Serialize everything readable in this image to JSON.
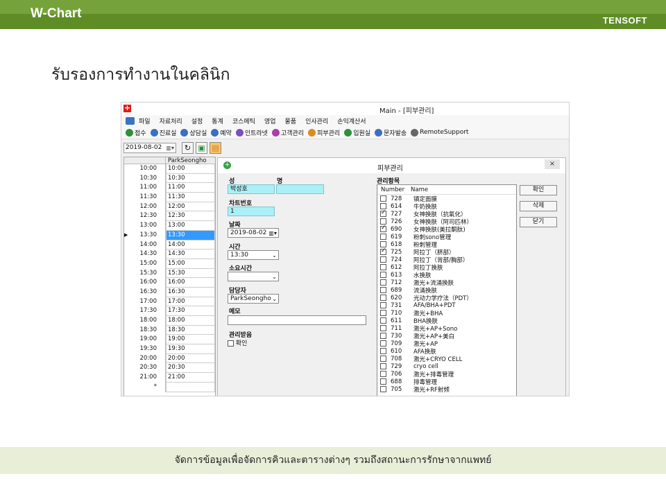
{
  "header": {
    "brand": "W-Chart",
    "company": "TENSOFT"
  },
  "slide_title": "รับรองการทำงานในคลินิก",
  "footer_text": "จัดการข้อมูลเพื่อจัดการคิวและตารางต่างๆ รวมถึงสถานะการรักษาจากแพทย์",
  "app": {
    "title": "Main - [피부관리]",
    "menu": [
      "파일",
      "자료처리",
      "설정",
      "통계",
      "코스메틱",
      "영업",
      "물품",
      "인사관리",
      "손익계산서"
    ],
    "toolbar": [
      {
        "label": "접수",
        "icon": "reception-icon",
        "color": "#2f8f3b"
      },
      {
        "label": "진료실",
        "icon": "doctor-icon",
        "color": "#3a6fc4"
      },
      {
        "label": "상담실",
        "icon": "consult-icon",
        "color": "#3a6fc4"
      },
      {
        "label": "예약",
        "icon": "reservation-icon",
        "color": "#3a6fc4"
      },
      {
        "label": "인트라넷",
        "icon": "intranet-icon",
        "color": "#7a4fc2"
      },
      {
        "label": "고객관리",
        "icon": "customer-icon",
        "color": "#b03ab0"
      },
      {
        "label": "피부관리",
        "icon": "skincare-icon",
        "color": "#e08a1e"
      },
      {
        "label": "입원실",
        "icon": "ward-icon",
        "color": "#2f8f3b"
      },
      {
        "label": "문자발송",
        "icon": "sms-icon",
        "color": "#3a6fc4"
      },
      {
        "label": "RemoteSupport",
        "icon": "remote-icon",
        "color": "#666666"
      }
    ],
    "date": "2019-08-02",
    "schedule": {
      "column": "ParkSeongho",
      "selected": "13:30",
      "rows": [
        {
          "time": "10:00",
          "cell": "10:00"
        },
        {
          "time": "10:30",
          "cell": "10:30"
        },
        {
          "time": "11:00",
          "cell": "11:00"
        },
        {
          "time": "11:30",
          "cell": "11:30"
        },
        {
          "time": "12:00",
          "cell": "12:00"
        },
        {
          "time": "12:30",
          "cell": "12:30"
        },
        {
          "time": "13:00",
          "cell": "13:00"
        },
        {
          "time": "13:30",
          "cell": "13:30"
        },
        {
          "time": "14:00",
          "cell": "14:00"
        },
        {
          "time": "14:30",
          "cell": "14:30"
        },
        {
          "time": "15:00",
          "cell": "15:00"
        },
        {
          "time": "15:30",
          "cell": "15:30"
        },
        {
          "time": "16:00",
          "cell": "16:00"
        },
        {
          "time": "16:30",
          "cell": "16:30"
        },
        {
          "time": "17:00",
          "cell": "17:00"
        },
        {
          "time": "17:30",
          "cell": "17:30"
        },
        {
          "time": "18:00",
          "cell": "18:00"
        },
        {
          "time": "18:30",
          "cell": "18:30"
        },
        {
          "time": "19:00",
          "cell": "19:00"
        },
        {
          "time": "19:30",
          "cell": "19:30"
        },
        {
          "time": "20:00",
          "cell": "20:00"
        },
        {
          "time": "20:30",
          "cell": "20:30"
        },
        {
          "time": "21:00",
          "cell": "21:00"
        },
        {
          "time": "*",
          "cell": ""
        }
      ]
    },
    "dialog": {
      "title": "피부관리",
      "close": "×",
      "surname_label": "성",
      "name_label": "명",
      "surname_value": "박성호",
      "name_value": "",
      "chart_label": "차트번호",
      "chart_value": "1",
      "date_label": "날짜",
      "date_value": "2019-08-02",
      "time_label": "시간",
      "time_value": "13:30",
      "duration_label": "소요시간",
      "duration_value": "",
      "staff_label": "담당자",
      "staff_value": "ParkSeongho",
      "memo_label": "메모",
      "memo_value": "",
      "received_label": "관리받음",
      "confirm_check_label": "확인",
      "items_label": "관리항목",
      "col_number": "Number",
      "col_name": "Name",
      "buttons": {
        "ok": "확인",
        "delete": "삭제",
        "close": "닫기"
      },
      "items": [
        {
          "num": "728",
          "name": "镇定面膜",
          "checked": false
        },
        {
          "num": "614",
          "name": "牛奶换肤",
          "checked": false
        },
        {
          "num": "727",
          "name": "女神换肤（抗氧化）",
          "checked": true
        },
        {
          "num": "726",
          "name": "女神换肤（阿司匹林）",
          "checked": false
        },
        {
          "num": "690",
          "name": "女神换肤(美拉酮肽)",
          "checked": true
        },
        {
          "num": "619",
          "name": "粉刺sono管理",
          "checked": false
        },
        {
          "num": "618",
          "name": "粉刺管理",
          "checked": false
        },
        {
          "num": "725",
          "name": "阿拉丁（脐部）",
          "checked": true
        },
        {
          "num": "724",
          "name": "阿拉丁（背部/胸部）",
          "checked": false
        },
        {
          "num": "612",
          "name": "阿拉丁换肤",
          "checked": false
        },
        {
          "num": "613",
          "name": "水换肤",
          "checked": false
        },
        {
          "num": "712",
          "name": "激光+流涌换肤",
          "checked": false
        },
        {
          "num": "689",
          "name": "流涌换肤",
          "checked": false
        },
        {
          "num": "620",
          "name": "光动力学疗法（PDT）",
          "checked": false
        },
        {
          "num": "731",
          "name": "AFA/BHA+PDT",
          "checked": false
        },
        {
          "num": "710",
          "name": "激光+BHA",
          "checked": false
        },
        {
          "num": "611",
          "name": "BHA换肤",
          "checked": false
        },
        {
          "num": "711",
          "name": "激光+AP+Sono",
          "checked": false
        },
        {
          "num": "730",
          "name": "激光+AP+美白",
          "checked": false
        },
        {
          "num": "709",
          "name": "激光+AP",
          "checked": false
        },
        {
          "num": "610",
          "name": "AFA换肤",
          "checked": false
        },
        {
          "num": "708",
          "name": "激光+CRYO CELL",
          "checked": false
        },
        {
          "num": "729",
          "name": "cryo cell",
          "checked": false
        },
        {
          "num": "706",
          "name": "激光+排毒管理",
          "checked": false
        },
        {
          "num": "688",
          "name": "排毒管理",
          "checked": false
        },
        {
          "num": "705",
          "name": "激光+RF射频",
          "checked": false
        }
      ]
    }
  }
}
